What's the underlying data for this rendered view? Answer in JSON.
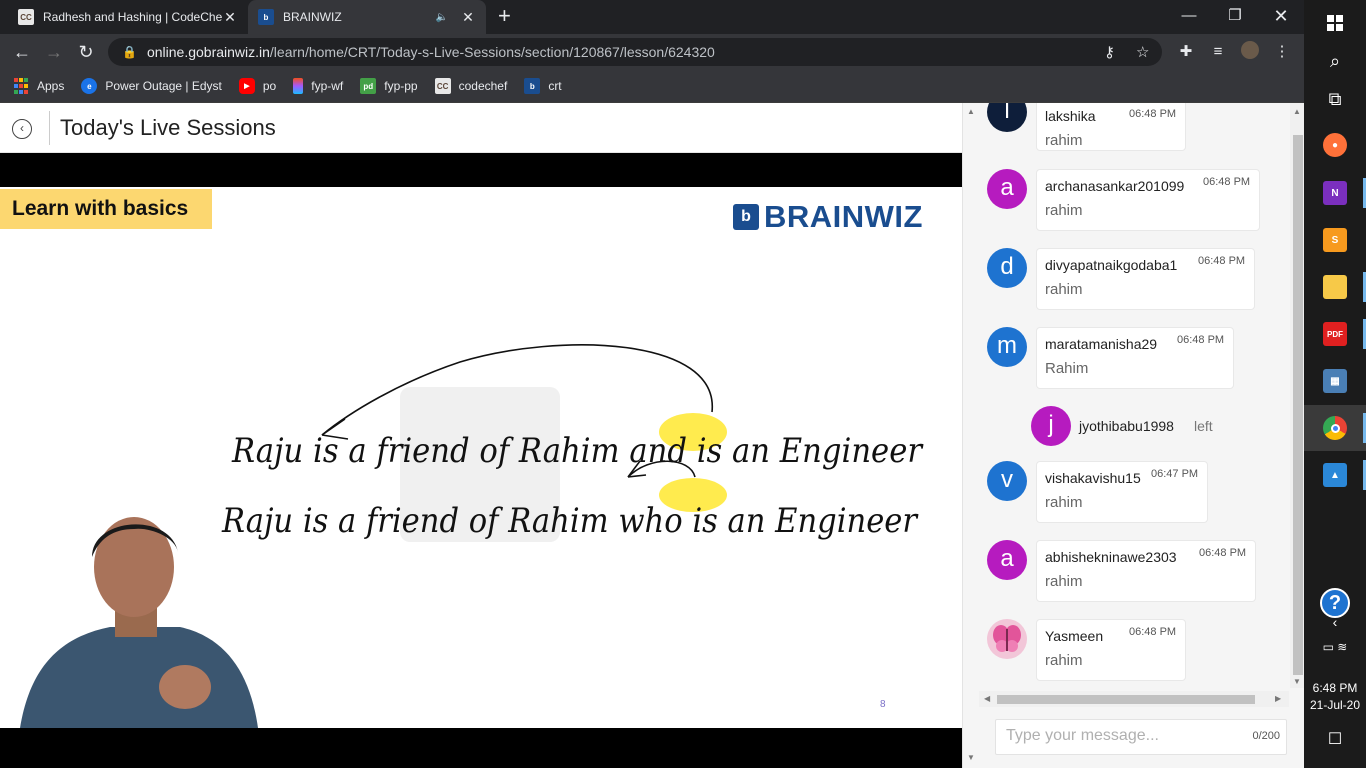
{
  "browser": {
    "tabs": [
      {
        "title": "Radhesh and Hashing | CodeChef",
        "favicon": "CC"
      },
      {
        "title": "BRAINWIZ",
        "favicon": "b"
      }
    ],
    "new_tab": "+",
    "url_host": "online.gobrainwiz.in",
    "url_path": "/learn/home/CRT/Today-s-Live-Sessions/section/120867/lesson/624320",
    "bookmarks": [
      {
        "label": "Apps",
        "icon": "apps-grid-icon",
        "color": "#ea4335"
      },
      {
        "label": "Power Outage | Edyst",
        "icon": "edyst-icon",
        "color": "#1a73e8"
      },
      {
        "label": "po",
        "icon": "youtube-icon",
        "color": "#ff0000"
      },
      {
        "label": "fyp-wf",
        "icon": "figma-icon",
        "color": "#f24e1e"
      },
      {
        "label": "fyp-pp",
        "icon": "pd-icon",
        "color": "#43a047"
      },
      {
        "label": "codechef",
        "icon": "codechef-icon",
        "color": "#5b4638"
      },
      {
        "label": "crt",
        "icon": "brainwiz-icon",
        "color": "#1a4d8f"
      }
    ]
  },
  "page": {
    "title": "Today's Live Sessions"
  },
  "slide": {
    "tag": "Learn with basics",
    "brand": "BRAINWIZ",
    "page_number": "8",
    "line1": "Raju is a friend of Rahim and is an Engineer",
    "line2": "Raju is a friend of Rahim who is an Engineer"
  },
  "chat": {
    "messages": [
      {
        "initial": "l",
        "user": "lakshika",
        "time": "06:48 PM",
        "text": "rahim",
        "color": "#0e1e3a"
      },
      {
        "initial": "a",
        "user": "archanasankar201099",
        "time": "06:48 PM",
        "text": "rahim",
        "color": "#b61bbf"
      },
      {
        "initial": "d",
        "user": "divyapatnaikgodaba1",
        "time": "06:48 PM",
        "text": "rahim",
        "color": "#1e73d0"
      },
      {
        "initial": "m",
        "user": "maratamanisha29",
        "time": "06:48 PM",
        "text": "Rahim",
        "color": "#1e73d0"
      },
      {
        "initial": "v",
        "user": "vishakavishu15",
        "time": "06:47 PM",
        "text": "rahim",
        "color": "#1e73d0"
      },
      {
        "initial": "a",
        "user": "abhishekninawe2303",
        "time": "06:48 PM",
        "text": "rahim",
        "color": "#b61bbf"
      },
      {
        "initial": "",
        "user": "Yasmeen",
        "time": "06:48 PM",
        "text": "rahim",
        "color": "#f2c6d8"
      }
    ],
    "system": {
      "initial": "j",
      "user": "jyothibabu1998",
      "text": "left",
      "color": "#b61bbf"
    },
    "input_placeholder": "Type your message...",
    "char_count": "0/200"
  },
  "taskbar": {
    "time": "6:48 PM",
    "date": "21-Jul-20"
  }
}
